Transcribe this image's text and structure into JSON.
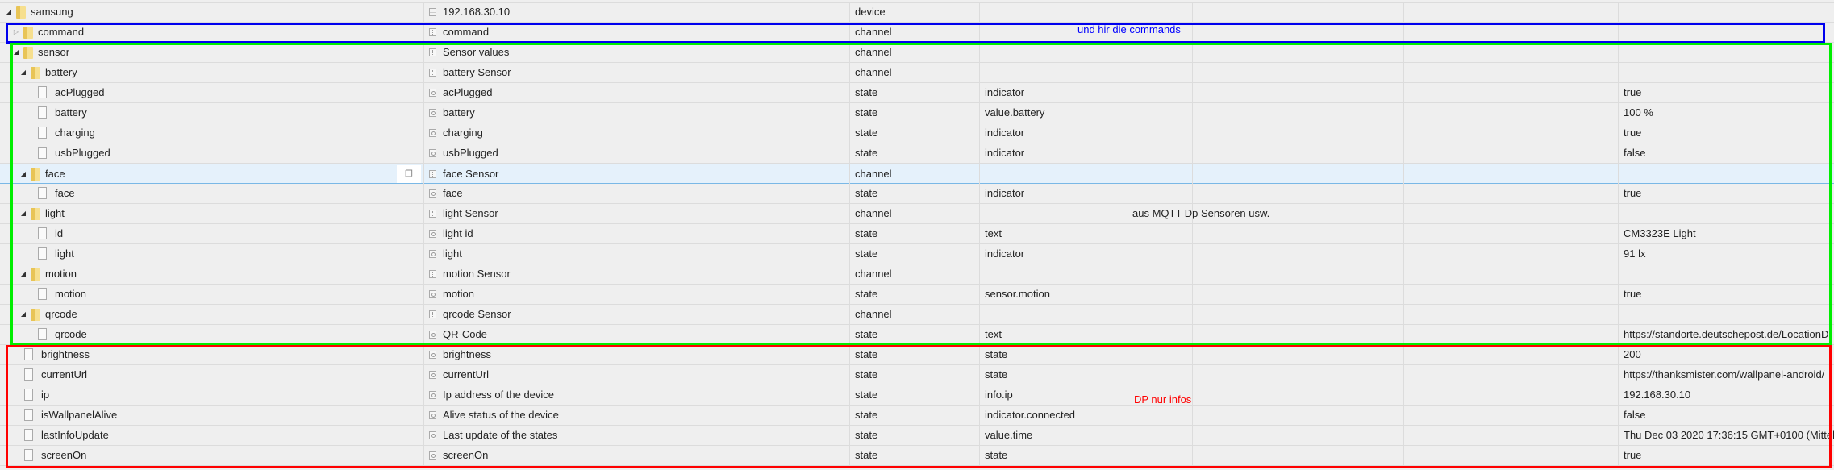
{
  "rows": [
    {
      "level": 0,
      "kind": "folder",
      "expand": "open",
      "name": "samsung",
      "icon": "device",
      "title": "192.168.30.10",
      "type": "device",
      "role": "",
      "value": ""
    },
    {
      "level": 1,
      "kind": "folder",
      "expand": "closed",
      "name": "command",
      "icon": "channel",
      "title": "command",
      "type": "channel",
      "role": "",
      "value": ""
    },
    {
      "level": 1,
      "kind": "folder",
      "expand": "open",
      "name": "sensor",
      "icon": "channel",
      "title": "Sensor values",
      "type": "channel",
      "role": "",
      "value": ""
    },
    {
      "level": 2,
      "kind": "folder",
      "expand": "open",
      "name": "battery",
      "icon": "channel",
      "title": "battery Sensor",
      "type": "channel",
      "role": "",
      "value": ""
    },
    {
      "level": 3,
      "kind": "file",
      "name": "acPlugged",
      "icon": "state",
      "title": "acPlugged",
      "type": "state",
      "role": "indicator",
      "value": "true"
    },
    {
      "level": 3,
      "kind": "file",
      "name": "battery",
      "icon": "state",
      "title": "battery",
      "type": "state",
      "role": "value.battery",
      "value": "100 %"
    },
    {
      "level": 3,
      "kind": "file",
      "name": "charging",
      "icon": "state",
      "title": "charging",
      "type": "state",
      "role": "indicator",
      "value": "true"
    },
    {
      "level": 3,
      "kind": "file",
      "name": "usbPlugged",
      "icon": "state",
      "title": "usbPlugged",
      "type": "state",
      "role": "indicator",
      "value": "false"
    },
    {
      "level": 2,
      "kind": "folder",
      "expand": "open",
      "name": "face",
      "icon": "channel",
      "title": "face Sensor",
      "type": "channel",
      "role": "",
      "value": "",
      "selected": true
    },
    {
      "level": 3,
      "kind": "file",
      "name": "face",
      "icon": "state",
      "title": "face",
      "type": "state",
      "role": "indicator",
      "value": "true"
    },
    {
      "level": 2,
      "kind": "folder",
      "expand": "open",
      "name": "light",
      "icon": "channel",
      "title": "light Sensor",
      "type": "channel",
      "role": "",
      "value": ""
    },
    {
      "level": 3,
      "kind": "file",
      "name": "id",
      "icon": "state",
      "title": "light id",
      "type": "state",
      "role": "text",
      "value": "CM3323E Light"
    },
    {
      "level": 3,
      "kind": "file",
      "name": "light",
      "icon": "state",
      "title": "light",
      "type": "state",
      "role": "indicator",
      "value": "91 lx"
    },
    {
      "level": 2,
      "kind": "folder",
      "expand": "open",
      "name": "motion",
      "icon": "channel",
      "title": "motion Sensor",
      "type": "channel",
      "role": "",
      "value": ""
    },
    {
      "level": 3,
      "kind": "file",
      "name": "motion",
      "icon": "state",
      "title": "motion",
      "type": "state",
      "role": "sensor.motion",
      "value": "true"
    },
    {
      "level": 2,
      "kind": "folder",
      "expand": "open",
      "name": "qrcode",
      "icon": "channel",
      "title": "qrcode Sensor",
      "type": "channel",
      "role": "",
      "value": ""
    },
    {
      "level": 3,
      "kind": "file",
      "name": "qrcode",
      "icon": "state",
      "title": "QR-Code",
      "type": "state",
      "role": "text",
      "value": "https://standorte.deutschepost.de/LocationD"
    },
    {
      "level": 1,
      "kind": "file",
      "name": "brightness",
      "icon": "state",
      "title": "brightness",
      "type": "state",
      "role": "state",
      "value": "200"
    },
    {
      "level": 1,
      "kind": "file",
      "name": "currentUrl",
      "icon": "state",
      "title": "currentUrl",
      "type": "state",
      "role": "state",
      "value": "https://thanksmister.com/wallpanel-android/"
    },
    {
      "level": 1,
      "kind": "file",
      "name": "ip",
      "icon": "state",
      "title": "Ip address of the device",
      "type": "state",
      "role": "info.ip",
      "value": "192.168.30.10"
    },
    {
      "level": 1,
      "kind": "file",
      "name": "isWallpanelAlive",
      "icon": "state",
      "title": "Alive status of the device",
      "type": "state",
      "role": "indicator.connected",
      "value": "false"
    },
    {
      "level": 1,
      "kind": "file",
      "name": "lastInfoUpdate",
      "icon": "state",
      "title": "Last update of the states",
      "type": "state",
      "role": "value.time",
      "value": "Thu Dec 03 2020 17:36:15 GMT+0100 (Mittel"
    },
    {
      "level": 1,
      "kind": "file",
      "name": "screenOn",
      "icon": "state",
      "title": "screenOn",
      "type": "state",
      "role": "state",
      "value": "true"
    }
  ],
  "annotations": {
    "commands": {
      "text": "und hir die commands",
      "color": "#0000ff"
    },
    "sensors": {
      "text": "aus MQTT Dp Sensoren usw.",
      "color": "#222222"
    },
    "infos": {
      "text": "DP nur infos",
      "color": "#ff0000"
    }
  },
  "colors": {
    "blue_box": "#0000ee",
    "green_box": "#00ee00",
    "red_box": "#ff0000",
    "selected_row": "#e5f1fb"
  }
}
